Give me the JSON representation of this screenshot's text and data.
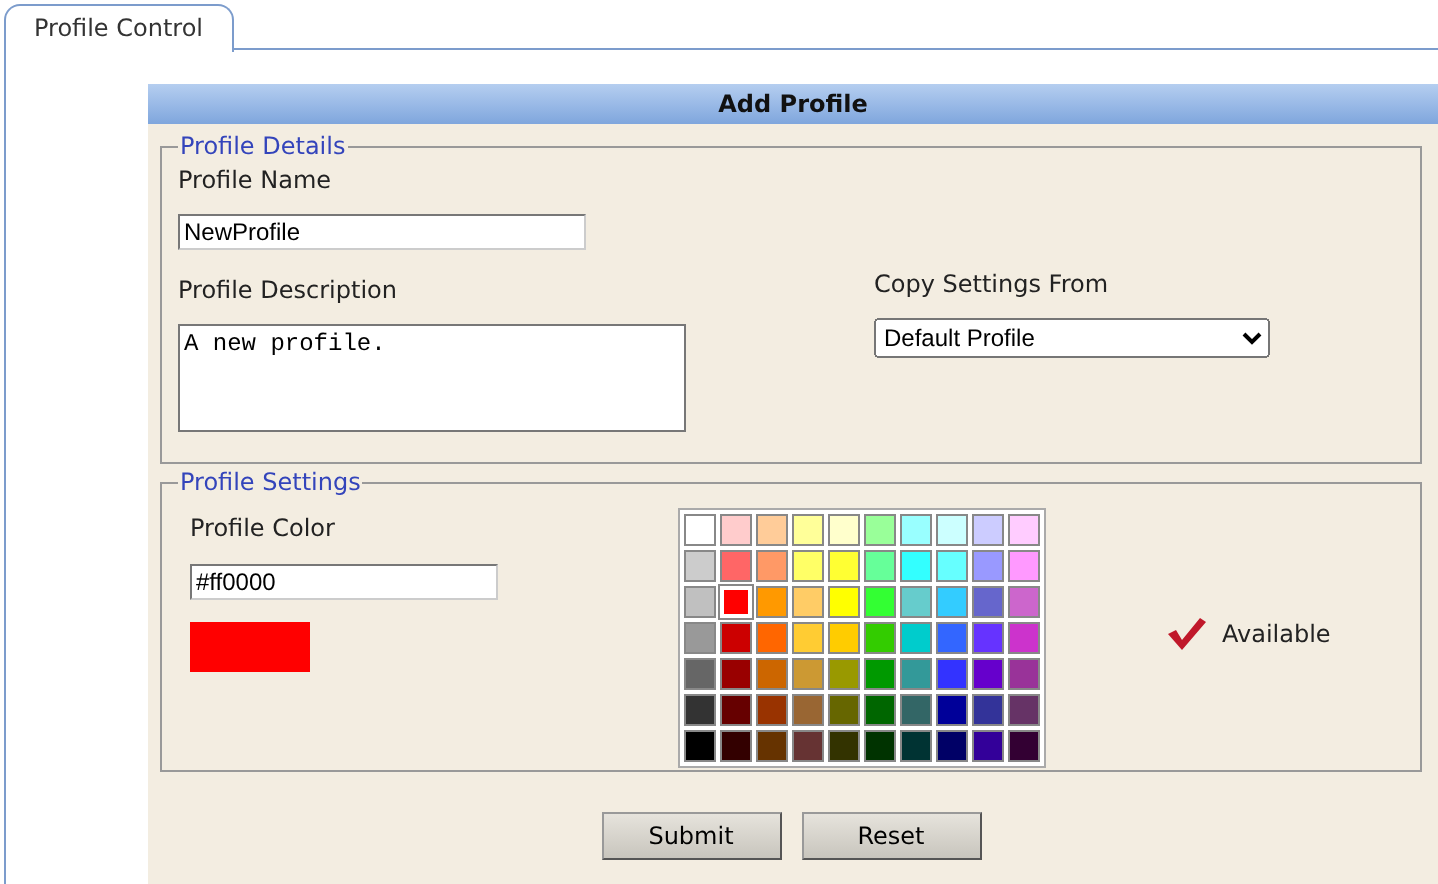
{
  "tabs": [
    {
      "label": "Profile Control",
      "selected": true
    }
  ],
  "form": {
    "title": "Add Profile",
    "details": {
      "legend": "Profile Details",
      "name_label": "Profile Name",
      "name_value": "NewProfile",
      "description_label": "Profile Description",
      "description_value": "A new profile.",
      "copy_label": "Copy Settings From",
      "copy_value": "Default Profile"
    },
    "settings": {
      "legend": "Profile Settings",
      "color_label": "Profile Color",
      "color_value": "#ff0000",
      "preview": {
        "color": "#ff0000"
      },
      "status": "Available",
      "palette": [
        [
          {
            "color": "#ffffff",
            "selected": false
          },
          {
            "color": "#ffcccc",
            "selected": false
          },
          {
            "color": "#ffcc99",
            "selected": false
          },
          {
            "color": "#ffff99",
            "selected": false
          },
          {
            "color": "#ffffcc",
            "selected": false
          },
          {
            "color": "#99ff99",
            "selected": false
          },
          {
            "color": "#99ffff",
            "selected": false
          },
          {
            "color": "#ccffff",
            "selected": false
          },
          {
            "color": "#ccccff",
            "selected": false
          },
          {
            "color": "#ffccff",
            "selected": false
          }
        ],
        [
          {
            "color": "#cccccc",
            "selected": false
          },
          {
            "color": "#ff6666",
            "selected": false
          },
          {
            "color": "#ff9966",
            "selected": false
          },
          {
            "color": "#ffff66",
            "selected": false
          },
          {
            "color": "#ffff33",
            "selected": false
          },
          {
            "color": "#66ff99",
            "selected": false
          },
          {
            "color": "#33ffff",
            "selected": false
          },
          {
            "color": "#66ffff",
            "selected": false
          },
          {
            "color": "#9999ff",
            "selected": false
          },
          {
            "color": "#ff99ff",
            "selected": false
          }
        ],
        [
          {
            "color": "#c0c0c0",
            "selected": false
          },
          {
            "color": "#ff0000",
            "selected": true
          },
          {
            "color": "#ff9900",
            "selected": false
          },
          {
            "color": "#ffcc66",
            "selected": false
          },
          {
            "color": "#ffff00",
            "selected": false
          },
          {
            "color": "#33ff33",
            "selected": false
          },
          {
            "color": "#66cccc",
            "selected": false
          },
          {
            "color": "#33ccff",
            "selected": false
          },
          {
            "color": "#6666cc",
            "selected": false
          },
          {
            "color": "#cc66cc",
            "selected": false
          }
        ],
        [
          {
            "color": "#999999",
            "selected": false
          },
          {
            "color": "#cc0000",
            "selected": false
          },
          {
            "color": "#ff6600",
            "selected": false
          },
          {
            "color": "#ffcc33",
            "selected": false
          },
          {
            "color": "#ffcc00",
            "selected": false
          },
          {
            "color": "#33cc00",
            "selected": false
          },
          {
            "color": "#00cccc",
            "selected": false
          },
          {
            "color": "#3366ff",
            "selected": false
          },
          {
            "color": "#6633ff",
            "selected": false
          },
          {
            "color": "#cc33cc",
            "selected": false
          }
        ],
        [
          {
            "color": "#666666",
            "selected": false
          },
          {
            "color": "#990000",
            "selected": false
          },
          {
            "color": "#cc6600",
            "selected": false
          },
          {
            "color": "#cc9933",
            "selected": false
          },
          {
            "color": "#999900",
            "selected": false
          },
          {
            "color": "#009900",
            "selected": false
          },
          {
            "color": "#339999",
            "selected": false
          },
          {
            "color": "#3333ff",
            "selected": false
          },
          {
            "color": "#6600cc",
            "selected": false
          },
          {
            "color": "#993399",
            "selected": false
          }
        ],
        [
          {
            "color": "#333333",
            "selected": false
          },
          {
            "color": "#660000",
            "selected": false
          },
          {
            "color": "#993300",
            "selected": false
          },
          {
            "color": "#996633",
            "selected": false
          },
          {
            "color": "#666600",
            "selected": false
          },
          {
            "color": "#006600",
            "selected": false
          },
          {
            "color": "#336666",
            "selected": false
          },
          {
            "color": "#000099",
            "selected": false
          },
          {
            "color": "#333399",
            "selected": false
          },
          {
            "color": "#663366",
            "selected": false
          }
        ],
        [
          {
            "color": "#000000",
            "selected": false
          },
          {
            "color": "#330000",
            "selected": false
          },
          {
            "color": "#663300",
            "selected": false
          },
          {
            "color": "#663333",
            "selected": false
          },
          {
            "color": "#333300",
            "selected": false
          },
          {
            "color": "#003300",
            "selected": false
          },
          {
            "color": "#003333",
            "selected": false
          },
          {
            "color": "#000066",
            "selected": false
          },
          {
            "color": "#330099",
            "selected": false
          },
          {
            "color": "#330033",
            "selected": false
          }
        ]
      ]
    },
    "buttons": [
      "Submit",
      "Reset"
    ]
  }
}
